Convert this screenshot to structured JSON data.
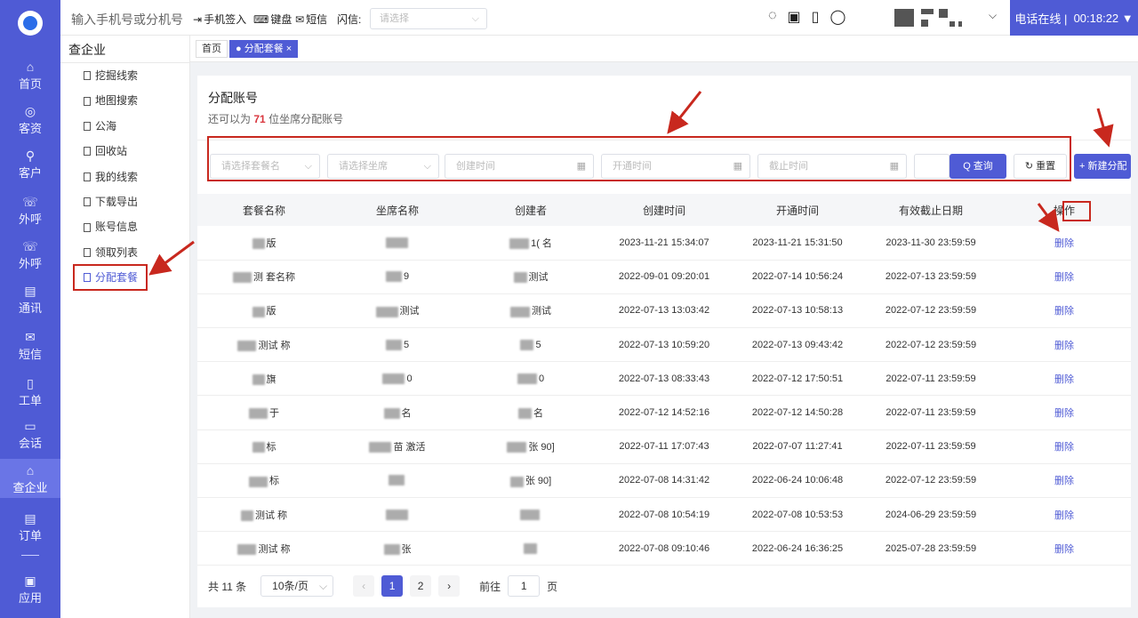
{
  "topbar": {
    "search_placeholder": "输入手机号或分机号",
    "checkin": "手机签入",
    "keyboard": "键盘",
    "sms": "短信",
    "flash_label": "闪信:",
    "flash_placeholder": "请选择",
    "status": "电话在线 |",
    "timer": "00:18:22"
  },
  "rail": {
    "items": [
      {
        "label": "首页",
        "icon": "home-icon"
      },
      {
        "label": "客资",
        "icon": "leads-icon"
      },
      {
        "label": "客户",
        "icon": "customer-icon"
      },
      {
        "label": "外呼",
        "icon": "call-out-icon"
      },
      {
        "label": "外呼",
        "icon": "call-out-2-icon"
      },
      {
        "label": "通讯",
        "icon": "contacts-icon"
      },
      {
        "label": "短信",
        "icon": "sms-icon"
      },
      {
        "label": "工单",
        "icon": "ticket-icon"
      },
      {
        "label": "会话",
        "icon": "chat-icon"
      },
      {
        "label": "查企业",
        "icon": "company-icon"
      },
      {
        "label": "订单",
        "icon": "order-icon"
      },
      {
        "label": "应用",
        "icon": "apps-icon"
      }
    ]
  },
  "side": {
    "title": "查企业",
    "items": [
      "挖掘线索",
      "地图搜索",
      "公海",
      "回收站",
      "我的线索",
      "下载导出",
      "账号信息",
      "领取列表",
      "分配套餐"
    ]
  },
  "tabs": {
    "home": "首页",
    "current": "● 分配套餐 ×"
  },
  "page": {
    "title": "分配账号",
    "quota_prefix": "还可以为",
    "quota_number": "71",
    "quota_suffix": "位坐席分配账号"
  },
  "filters": {
    "package_placeholder": "请选择套餐名",
    "seat_placeholder": "请选择坐席",
    "created_placeholder": "创建时间",
    "opened_placeholder": "开通时间",
    "expire_placeholder": "截止时间",
    "query": "Q 查询",
    "reset": "↻ 重置",
    "new": "+ 新建分配"
  },
  "table": {
    "headers": [
      "套餐名称",
      "坐席名称",
      "创建者",
      "创建时间",
      "开通时间",
      "有效截止日期",
      "操作"
    ],
    "rows": [
      {
        "pkg": "版",
        "seat": "",
        "creator": "1( 名",
        "created": "2023-11-21 15:34:07",
        "opened": "2023-11-21 15:31:50",
        "expire": "2023-11-30 23:59:59",
        "action": "删除"
      },
      {
        "pkg": "测 套名称",
        "seat": "9",
        "creator": "测试",
        "created": "2022-09-01 09:20:01",
        "opened": "2022-07-14 10:56:24",
        "expire": "2022-07-13 23:59:59",
        "action": "删除"
      },
      {
        "pkg": "版",
        "seat": "测试",
        "creator": "测试",
        "created": "2022-07-13 13:03:42",
        "opened": "2022-07-13 10:58:13",
        "expire": "2022-07-12 23:59:59",
        "action": "删除"
      },
      {
        "pkg": "测试 称",
        "seat": "5",
        "creator": "5",
        "created": "2022-07-13 10:59:20",
        "opened": "2022-07-13 09:43:42",
        "expire": "2022-07-12 23:59:59",
        "action": "删除"
      },
      {
        "pkg": "旗",
        "seat": "0",
        "creator": "0",
        "created": "2022-07-13 08:33:43",
        "opened": "2022-07-12 17:50:51",
        "expire": "2022-07-11 23:59:59",
        "action": "删除"
      },
      {
        "pkg": "于",
        "seat": "名",
        "creator": "名",
        "created": "2022-07-12 14:52:16",
        "opened": "2022-07-12 14:50:28",
        "expire": "2022-07-11 23:59:59",
        "action": "删除"
      },
      {
        "pkg": "标",
        "seat": "苗 激活",
        "creator": "张 90]",
        "created": "2022-07-11 17:07:43",
        "opened": "2022-07-07 11:27:41",
        "expire": "2022-07-11 23:59:59",
        "action": "删除"
      },
      {
        "pkg": "标",
        "seat": "",
        "creator": "张 90]",
        "created": "2022-07-08 14:31:42",
        "opened": "2022-06-24 10:06:48",
        "expire": "2022-07-12 23:59:59",
        "action": "删除"
      },
      {
        "pkg": "测试 称",
        "seat": "",
        "creator": "",
        "created": "2022-07-08 10:54:19",
        "opened": "2022-07-08 10:53:53",
        "expire": "2024-06-29 23:59:59",
        "action": "删除"
      },
      {
        "pkg": "测试 称",
        "seat": "张",
        "creator": "",
        "created": "2022-07-08 09:10:46",
        "opened": "2022-06-24 16:36:25",
        "expire": "2025-07-28 23:59:59",
        "action": "删除"
      }
    ]
  },
  "pager": {
    "total": "共 11 条",
    "size": "10条/页",
    "pages": [
      "1",
      "2"
    ],
    "goto_label": "前往",
    "goto_value": "1",
    "page_unit": "页"
  },
  "colors": {
    "accent": "#4f5bd5",
    "annotation": "#c8281e"
  }
}
